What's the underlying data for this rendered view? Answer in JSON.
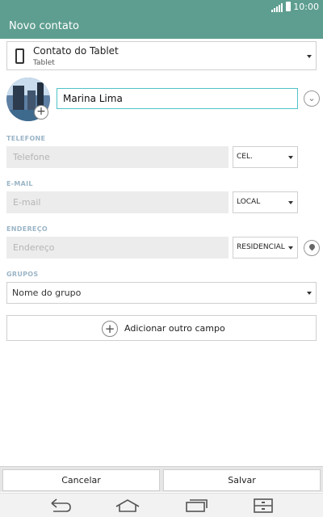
{
  "status_bar": {
    "time": "10:00"
  },
  "header": {
    "title": "Novo contato"
  },
  "account": {
    "name": "Contato do Tablet",
    "type": "Tablet"
  },
  "name_field": {
    "value": "Marina Lima"
  },
  "phone": {
    "section": "TELEFONE",
    "placeholder": "Telefone",
    "type": "CEL."
  },
  "email": {
    "section": "E-MAIL",
    "placeholder": "E-mail",
    "type": "LOCAL"
  },
  "address": {
    "section": "ENDEREÇO",
    "placeholder": "Endereço",
    "type": "RESIDENCIAL"
  },
  "groups": {
    "section": "GRUPOS",
    "placeholder": "Nome do grupo"
  },
  "add_field": {
    "label": "Adicionar outro campo"
  },
  "actions": {
    "cancel": "Cancelar",
    "save": "Salvar"
  },
  "icons": [
    "signal-icon",
    "battery-icon",
    "tablet-icon",
    "add-photo-icon",
    "expand-icon",
    "location-icon",
    "add-icon",
    "back-icon",
    "home-icon",
    "recent-apps-icon",
    "menu-icon"
  ],
  "colors": {
    "header": "#5e9e90",
    "focus_border": "#4fc3c8",
    "section_label": "#9bb5c7"
  }
}
